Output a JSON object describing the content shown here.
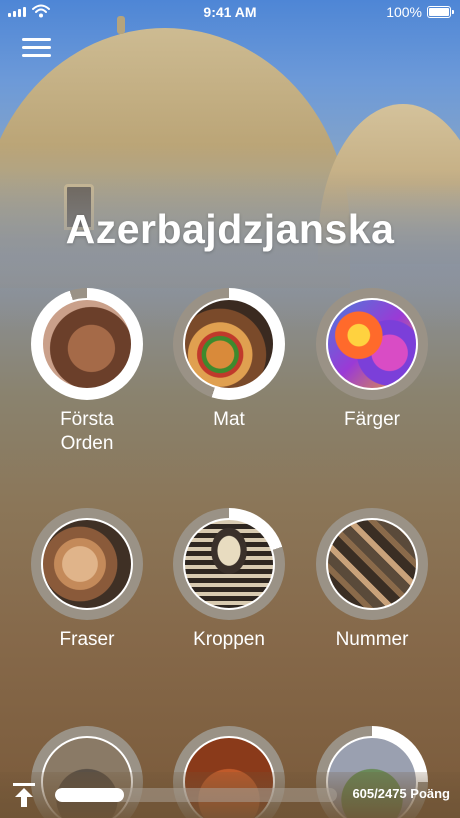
{
  "status_bar": {
    "time": "9:41 AM",
    "battery": "100%"
  },
  "header": {
    "title": "Azerbajdzjanska"
  },
  "topics": [
    {
      "label": "Första\nOrden",
      "progress": 0.95,
      "image": "child-face"
    },
    {
      "label": "Mat",
      "progress": 0.55,
      "image": "burger-food"
    },
    {
      "label": "Färger",
      "progress": 0.0,
      "image": "color-powder"
    },
    {
      "label": "Fraser",
      "progress": 0.0,
      "image": "smiling-woman"
    },
    {
      "label": "Kroppen",
      "progress": 0.2,
      "image": "skeleton"
    },
    {
      "label": "Nummer",
      "progress": 0.0,
      "image": "wooden-numbers"
    },
    {
      "label": "",
      "progress": 0.0,
      "image": "partial-topic"
    },
    {
      "label": "",
      "progress": 0.0,
      "image": "partial-topic"
    },
    {
      "label": "",
      "progress": 0.25,
      "image": "partial-topic"
    }
  ],
  "footer": {
    "points": "605/2475 Poäng",
    "progress": 0.244
  },
  "colors": {
    "ring_track": "#9a9286",
    "ring_fill": "#ffffff",
    "progress_fill": "#ffffff"
  }
}
